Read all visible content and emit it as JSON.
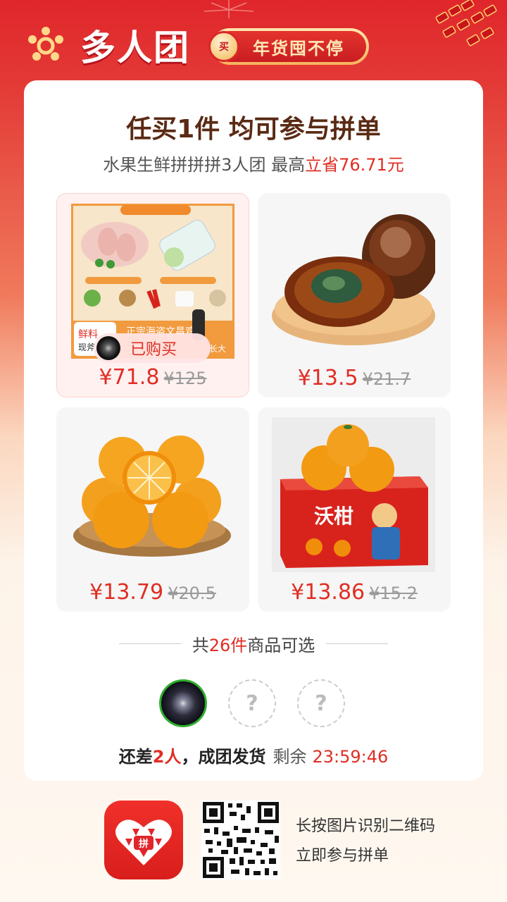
{
  "header": {
    "brand_title": "多人团",
    "promo_text": "年货囤不停",
    "promo_badge": "买"
  },
  "card": {
    "title": "任买1件 均可参与拼单",
    "subtitle_prefix": "水果生鲜拼拼拼3人团 最高",
    "subtitle_highlight": "立省76.71元"
  },
  "products": [
    {
      "name": "chicken-feet-bundle",
      "price": "¥71.8",
      "old_price": "¥125",
      "bought_label": "已购买",
      "selected": true
    },
    {
      "name": "preserved-eggs",
      "price": "¥13.5",
      "old_price": "¥21.7"
    },
    {
      "name": "navel-oranges",
      "price": "¥13.79",
      "old_price": "¥20.5"
    },
    {
      "name": "wogan-tangerines-box",
      "price": "¥13.86",
      "old_price": "¥15.2"
    }
  ],
  "selection": {
    "prefix": "共",
    "count": "26件",
    "suffix": "商品可选"
  },
  "group": {
    "status_prefix": "还差",
    "remaining_count": "2人",
    "status_suffix": "，成团发货",
    "time_label": "剩余",
    "timer": "23:59:46",
    "empty_slot_glyph": "?"
  },
  "footer": {
    "line1": "长按图片识别二维码",
    "line2": "立即参与拼单"
  },
  "colors": {
    "accent_red": "#e02e24",
    "header_red": "#e0262b",
    "title_brown": "#5a2a14"
  }
}
